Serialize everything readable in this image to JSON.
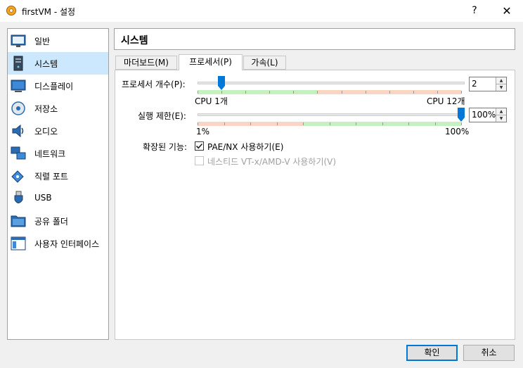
{
  "window": {
    "title": "firstVM - 설정",
    "help_label": "?",
    "close_label": "✕"
  },
  "sidebar": {
    "items": [
      {
        "label": "일반",
        "icon": "general-icon"
      },
      {
        "label": "시스템",
        "icon": "system-icon",
        "selected": true
      },
      {
        "label": "디스플레이",
        "icon": "display-icon"
      },
      {
        "label": "저장소",
        "icon": "storage-icon"
      },
      {
        "label": "오디오",
        "icon": "audio-icon"
      },
      {
        "label": "네트워크",
        "icon": "network-icon"
      },
      {
        "label": "직렬 포트",
        "icon": "serial-port-icon"
      },
      {
        "label": "USB",
        "icon": "usb-icon"
      },
      {
        "label": "공유 폴더",
        "icon": "shared-folder-icon"
      },
      {
        "label": "사용자 인터페이스",
        "icon": "user-interface-icon"
      }
    ]
  },
  "page": {
    "title": "시스템"
  },
  "tabs": [
    {
      "label": "마더보드(M)"
    },
    {
      "label": "프로세서(P)",
      "active": true
    },
    {
      "label": "가속(L)"
    }
  ],
  "processor": {
    "count_label": "프로세서 개수(P):",
    "count_value": "2",
    "count_min_label": "CPU 1개",
    "count_max_label": "CPU 12개",
    "count_fraction": 0.09
  },
  "exec_cap": {
    "label": "실행 제한(E):",
    "value": "100%",
    "min_label": "1%",
    "max_label": "100%",
    "fraction": 1.0
  },
  "features": {
    "label": "확장된 기능:",
    "pae_label": "PAE/NX 사용하기(E)",
    "pae_checked": true,
    "nested_label": "네스티드 VT-x/AMD-V 사용하기(V)",
    "nested_checked": false
  },
  "buttons": {
    "ok": "확인",
    "cancel": "취소"
  },
  "colors": {
    "accent": "#0078d7",
    "selected_bg": "#cce8ff",
    "range_green": "#c6f0c2",
    "range_red": "#fad4c4"
  }
}
